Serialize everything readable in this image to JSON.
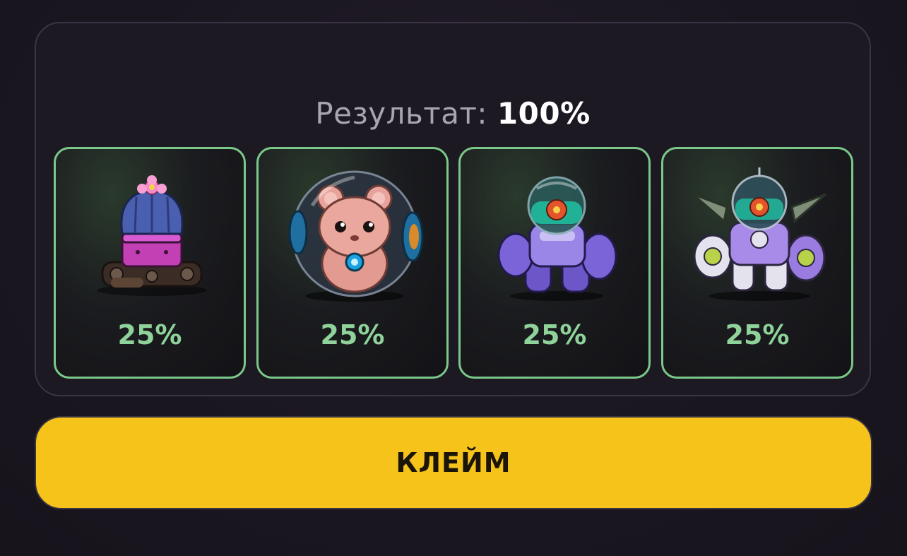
{
  "result": {
    "label": "Результат: ",
    "value": "100%"
  },
  "cards": [
    {
      "icon": "cactus-tank-icon",
      "percent": "25%"
    },
    {
      "icon": "hamster-ball-icon",
      "percent": "25%"
    },
    {
      "icon": "robot-mech-icon",
      "percent": "25%"
    },
    {
      "icon": "robot-mech-winged-icon",
      "percent": "25%"
    }
  ],
  "claim_button": {
    "label": "КЛЕЙМ"
  },
  "colors": {
    "accent_yellow": "#f6c31a",
    "card_border": "#7bc98a",
    "percent_green": "#8fd39b",
    "background": "#1b1720"
  }
}
